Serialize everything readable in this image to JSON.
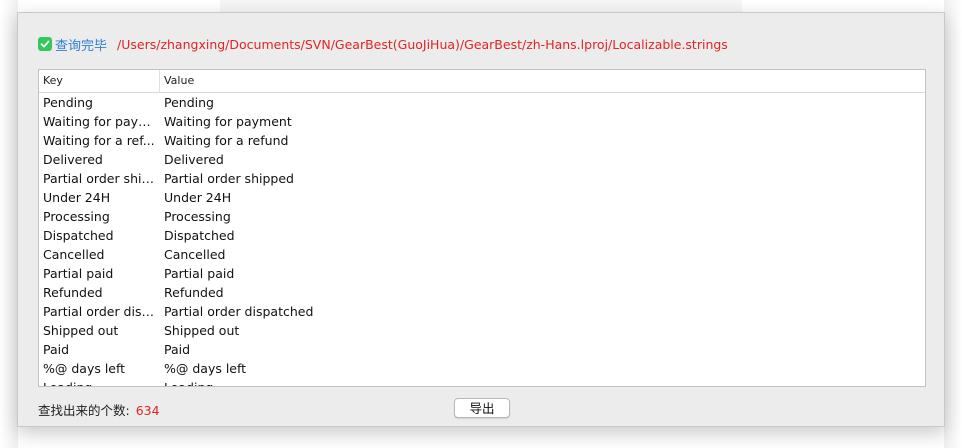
{
  "status": {
    "done_label": "查询完毕",
    "file_path": "/Users/zhangxing/Documents/SVN/GearBest(GuoJiHua)/GearBest/zh-Hans.lproj/Localizable.strings"
  },
  "table": {
    "columns": {
      "key": "Key",
      "value": "Value"
    },
    "rows": [
      {
        "key": "Pending",
        "value": "Pending"
      },
      {
        "key": "Waiting for paym...",
        "value": "Waiting for payment"
      },
      {
        "key": "Waiting for a ref...",
        "value": "Waiting for a refund"
      },
      {
        "key": "Delivered",
        "value": "Delivered"
      },
      {
        "key": "Partial order ship...",
        "value": "Partial order shipped"
      },
      {
        "key": "Under 24H",
        "value": "Under 24H"
      },
      {
        "key": "Processing",
        "value": "Processing"
      },
      {
        "key": "Dispatched",
        "value": "Dispatched"
      },
      {
        "key": "Cancelled",
        "value": "Cancelled"
      },
      {
        "key": "Partial paid",
        "value": "Partial paid"
      },
      {
        "key": "Refunded",
        "value": "Refunded"
      },
      {
        "key": "Partial order disp...",
        "value": "Partial order dispatched"
      },
      {
        "key": "Shipped out",
        "value": "Shipped out"
      },
      {
        "key": "Paid",
        "value": "Paid"
      },
      {
        "key": "%@ days left",
        "value": "%@ days left"
      },
      {
        "key": "Loading",
        "value": "Loading"
      }
    ]
  },
  "footer": {
    "count_label": "查找出来的个数:",
    "count_value": "634",
    "export_label": "导出"
  },
  "icons": {
    "status": "check-mark-icon"
  },
  "colors": {
    "status_text": "#2f7fd8",
    "path_text": "#e02424",
    "count_value": "#e02424",
    "check_icon": "#34c759"
  }
}
